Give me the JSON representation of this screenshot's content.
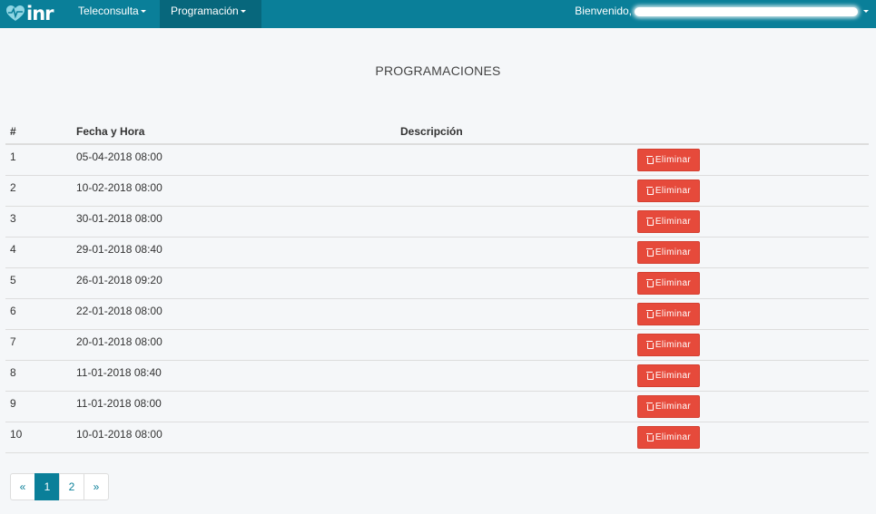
{
  "brand": {
    "logo_text": "inr"
  },
  "nav": {
    "items": [
      {
        "label": "Teleconsulta"
      },
      {
        "label": "Programación"
      }
    ],
    "welcome_label": "Bienvenido,"
  },
  "page": {
    "title": "PROGRAMACIONES"
  },
  "table": {
    "headers": {
      "index": "#",
      "datetime": "Fecha y Hora",
      "description": "Descripción"
    },
    "delete_label": "Eliminar",
    "rows": [
      {
        "index": "1",
        "datetime": "05-04-2018 08:00",
        "description": ""
      },
      {
        "index": "2",
        "datetime": "10-02-2018 08:00",
        "description": ""
      },
      {
        "index": "3",
        "datetime": "30-01-2018 08:00",
        "description": ""
      },
      {
        "index": "4",
        "datetime": "29-01-2018 08:40",
        "description": ""
      },
      {
        "index": "5",
        "datetime": "26-01-2018 09:20",
        "description": ""
      },
      {
        "index": "6",
        "datetime": "22-01-2018 08:00",
        "description": ""
      },
      {
        "index": "7",
        "datetime": "20-01-2018 08:00",
        "description": ""
      },
      {
        "index": "8",
        "datetime": "11-01-2018 08:40",
        "description": ""
      },
      {
        "index": "9",
        "datetime": "11-01-2018 08:00",
        "description": ""
      },
      {
        "index": "10",
        "datetime": "10-01-2018 08:00",
        "description": ""
      }
    ]
  },
  "pagination": {
    "prev": "«",
    "pages": [
      "1",
      "2"
    ],
    "active_page": "1",
    "next": "»"
  },
  "colors": {
    "navbar": "#0a7f99",
    "navbar_active": "#07677c",
    "danger": "#e64a3b",
    "background": "#f5f7f9"
  }
}
